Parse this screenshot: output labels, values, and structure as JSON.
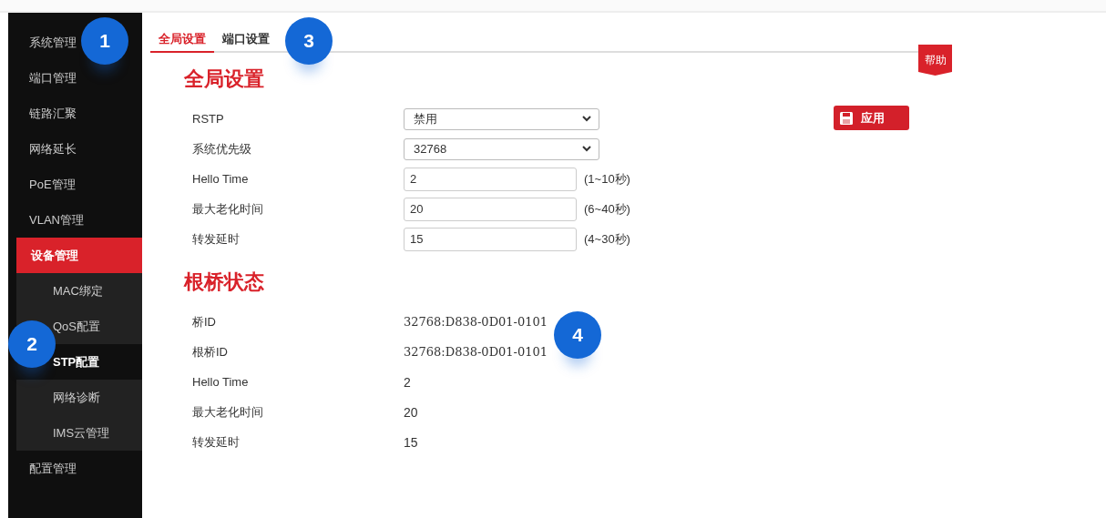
{
  "sidebar": {
    "items": [
      {
        "label": "系统管理",
        "selected": false
      },
      {
        "label": "端口管理",
        "selected": false
      },
      {
        "label": "链路汇聚",
        "selected": false
      },
      {
        "label": "网络延长",
        "selected": false
      },
      {
        "label": "PoE管理",
        "selected": false
      },
      {
        "label": "VLAN管理",
        "selected": false
      },
      {
        "label": "设备管理",
        "selected": true,
        "expanded": true,
        "children": [
          {
            "label": "MAC绑定",
            "selected": false
          },
          {
            "label": "QoS配置",
            "selected": false
          },
          {
            "label": "STP配置",
            "selected": true
          },
          {
            "label": "网络诊断",
            "selected": false
          },
          {
            "label": "IMS云管理",
            "selected": false
          }
        ]
      },
      {
        "label": "配置管理",
        "selected": false
      }
    ]
  },
  "tabs": [
    {
      "label": "全局设置",
      "selected": true
    },
    {
      "label": "端口设置",
      "selected": false
    }
  ],
  "help": "帮助",
  "global_settings": {
    "title": "全局设置",
    "apply_button": "应用",
    "rows": [
      {
        "label": "RSTP",
        "kind": "select",
        "value": "禁用"
      },
      {
        "label": "系统优先级",
        "kind": "select",
        "value": "32768"
      },
      {
        "label": "Hello Time",
        "kind": "input",
        "value": "2",
        "hint": "(1~10秒)"
      },
      {
        "label": "最大老化时间",
        "kind": "input",
        "value": "20",
        "hint": "(6~40秒)"
      },
      {
        "label": "转发延时",
        "kind": "input",
        "value": "15",
        "hint": "(4~30秒)"
      }
    ]
  },
  "root_bridge_status": {
    "title": "根桥状态",
    "rows": [
      {
        "label": "桥ID",
        "value": "32768:D838-0D01-0101",
        "kind": "id"
      },
      {
        "label": "根桥ID",
        "value": "32768:D838-0D01-0101",
        "kind": "id"
      },
      {
        "label": "Hello Time",
        "value": "2",
        "kind": "plain"
      },
      {
        "label": "最大老化时间",
        "value": "20",
        "kind": "plain"
      },
      {
        "label": "转发延时",
        "value": "15",
        "kind": "plain"
      }
    ]
  },
  "callouts": [
    {
      "label": "1"
    },
    {
      "label": "2"
    },
    {
      "label": "3"
    },
    {
      "label": "4"
    }
  ]
}
